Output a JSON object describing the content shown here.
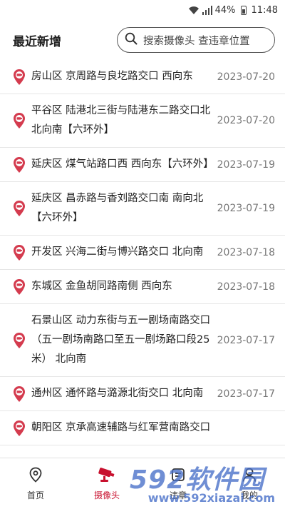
{
  "status_bar": {
    "battery": "44%",
    "time": "11:48"
  },
  "header": {
    "title": "最近新增",
    "search_placeholder": "搜索摄像头 查违章位置"
  },
  "list": [
    {
      "address": "房山区 京周路与良圪路交口 西向东",
      "date": "2023-07-20"
    },
    {
      "address": "平谷区 陆港北三街与陆港东二路交口北 北向南【六环外】",
      "date": "2023-07-20"
    },
    {
      "address": "延庆区 煤气站路口西 西向东【六环外】",
      "date": "2023-07-19"
    },
    {
      "address": "延庆区 昌赤路与香刘路交口南 南向北【六环外】",
      "date": "2023-07-19"
    },
    {
      "address": "开发区 兴海二街与博兴路交口 北向南",
      "date": "2023-07-18"
    },
    {
      "address": "东城区 金鱼胡同路南侧 西向东",
      "date": "2023-07-18"
    },
    {
      "address": "石景山区 动力东街与五一剧场南路交口（五一剧场南路口至五一剧场路口段25米） 北向南",
      "date": "2023-07-17"
    },
    {
      "address": "通州区 通怀路与潞源北街交口 北向南",
      "date": "2023-07-17"
    },
    {
      "address": "朝阳区 京承高速辅路与红军营南路交口",
      "date": ""
    }
  ],
  "nav": [
    {
      "label": "首页",
      "icon": "location-pin-icon"
    },
    {
      "label": "摄像头",
      "icon": "camera-icon"
    },
    {
      "label": "违章",
      "icon": "ticket-icon"
    },
    {
      "label": "我的",
      "icon": "user-icon"
    }
  ],
  "colors": {
    "accent": "#c8102e",
    "pin": "#d43b4e"
  },
  "watermark": {
    "big": "592软件园",
    "small": "www.592xiazai.com"
  }
}
